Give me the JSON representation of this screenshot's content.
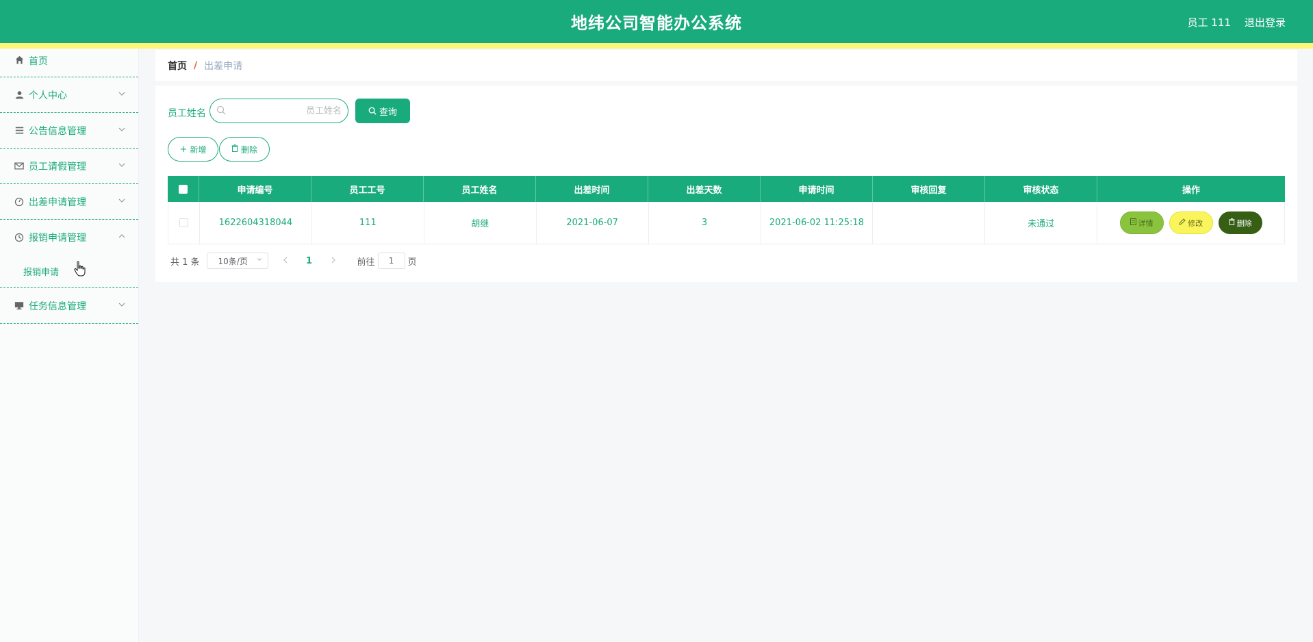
{
  "header": {
    "title": "地纬公司智能办公系统",
    "user_label": "员工 111",
    "logout_label": "退出登录",
    "color": "#1aab7c",
    "stripe_color": "#fdf67a"
  },
  "sidebar": {
    "items": [
      {
        "label": "首页",
        "icon": "home-icon"
      },
      {
        "label": "个人中心",
        "icon": "user-icon"
      },
      {
        "label": "公告信息管理",
        "icon": "list-icon"
      },
      {
        "label": "员工请假管理",
        "icon": "mail-icon"
      },
      {
        "label": "出差申请管理",
        "icon": "gauge-icon"
      },
      {
        "label": "报销申请管理",
        "icon": "clock-icon"
      },
      {
        "label": "任务信息管理",
        "icon": "monitor-icon"
      }
    ],
    "submenu_label": "报销申请"
  },
  "breadcrumb": {
    "home": "首页",
    "separator": "/",
    "current": "出差申请"
  },
  "search": {
    "label": "员工姓名",
    "placeholder": "员工姓名",
    "query_label": "查询"
  },
  "actions": {
    "add_label": "新增",
    "delete_label": "删除"
  },
  "table": {
    "headers": [
      "申请编号",
      "员工工号",
      "员工姓名",
      "出差时间",
      "出差天数",
      "申请时间",
      "审核回复",
      "审核状态",
      "操作"
    ],
    "rows": [
      {
        "cells": [
          "1622604318044",
          "111",
          "胡继",
          "2021-06-07",
          "3",
          "2021-06-02 11:25:18",
          "",
          "未通过"
        ],
        "detail_label": "详情",
        "edit_label": "修改",
        "delete_label": "删除"
      }
    ]
  },
  "pager": {
    "total": "共 1 条",
    "page_size": "10条/页",
    "current_page": "1",
    "goto_label": "前往",
    "goto_value": "1",
    "page_suffix": "页"
  }
}
